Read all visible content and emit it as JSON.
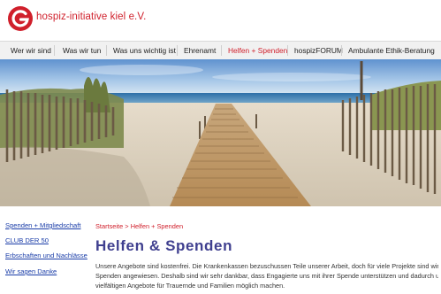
{
  "brand": {
    "name": "hospiz-initiative kiel e.V.",
    "color": "#d01f2b",
    "logo_icon": "hospiz-g-logo-icon"
  },
  "nav": {
    "items": [
      {
        "label": "Wer wir sind",
        "active": false
      },
      {
        "label": "Was wir tun",
        "active": false
      },
      {
        "label": "Was uns wichtig ist",
        "active": false
      },
      {
        "label": "Ehrenamt",
        "active": false
      },
      {
        "label": "Helfen + Spenden",
        "active": true
      },
      {
        "label": "hospizFORUM",
        "active": false
      },
      {
        "label": "Ambulante Ethik-Beratung",
        "active": false
      }
    ]
  },
  "hero": {
    "icon": "beach-boardwalk-photo"
  },
  "sidebar": {
    "links": [
      {
        "label": "Spenden + Mitgliedschaft"
      },
      {
        "label": "CLUB DER 50"
      },
      {
        "label": "Erbschaften und Nachlässe"
      },
      {
        "label": "Wir sagen Danke"
      }
    ]
  },
  "breadcrumb": {
    "home": "Startseite",
    "separator": ">",
    "current": "Helfen + Spenden"
  },
  "main": {
    "title": "Helfen & Spenden",
    "lines": [
      "Unsere Angebote sind kostenfrei. Die Krankenkassen bezuschussen Teile unserer Arbeit, doch für viele Projekte sind wir auf",
      "Spenden angewiesen. Deshalb sind wir sehr dankbar, dass Engagierte uns mit ihrer Spende unterstützen und dadurch unsere",
      "vielfältigen Angebote für Trauernde und Familien möglich machen."
    ]
  }
}
